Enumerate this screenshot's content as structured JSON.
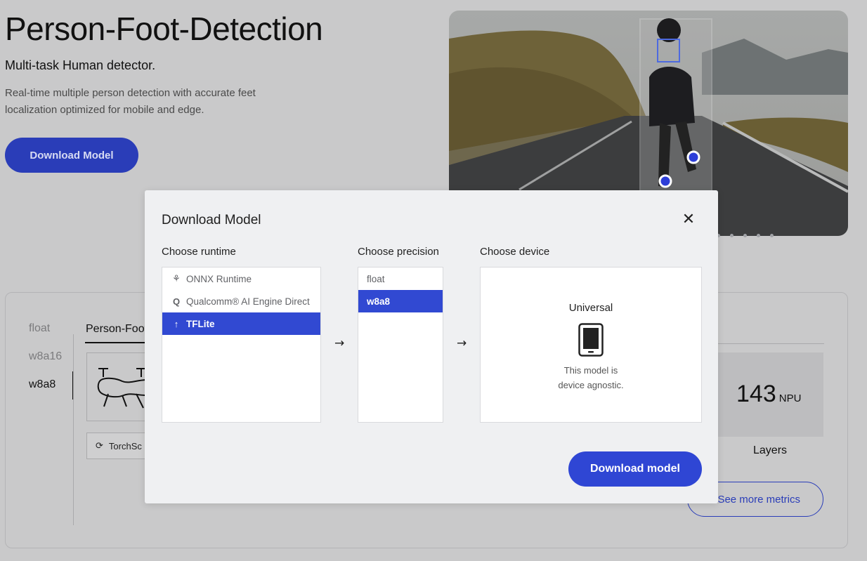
{
  "hero": {
    "title": "Person-Foot-Detection",
    "subtitle": "Multi-task Human detector.",
    "description": "Real-time multiple person detection with accurate feet localization optimized for mobile and edge.",
    "download_button": "Download Model"
  },
  "panel": {
    "precision_tabs": [
      {
        "label": "float",
        "active": false
      },
      {
        "label": "w8a16",
        "active": false
      },
      {
        "label": "w8a8",
        "active": true
      }
    ],
    "model_tab": "Person-Foot",
    "runtime_chip": "TorchSc",
    "metric": {
      "value": "143",
      "unit": "NPU",
      "label": "Layers"
    },
    "more_metrics_button": "See more metrics"
  },
  "modal": {
    "title": "Download Model",
    "runtime": {
      "label": "Choose runtime",
      "options": [
        {
          "label": "ONNX Runtime",
          "icon": "onnx-icon",
          "selected": false
        },
        {
          "label": "Qualcomm® AI Engine Direct",
          "icon": "qualcomm-icon",
          "selected": false
        },
        {
          "label": "TFLite",
          "icon": "tflite-icon",
          "selected": true
        }
      ]
    },
    "precision": {
      "label": "Choose precision",
      "options": [
        {
          "label": "float",
          "selected": false
        },
        {
          "label": "w8a8",
          "selected": true
        }
      ]
    },
    "device": {
      "label": "Choose device",
      "name": "Universal",
      "note_line1": "This model is",
      "note_line2": "device agnostic."
    },
    "download_button": "Download model"
  },
  "colors": {
    "accent": "#2f46d4",
    "selected": "#3149d2"
  }
}
